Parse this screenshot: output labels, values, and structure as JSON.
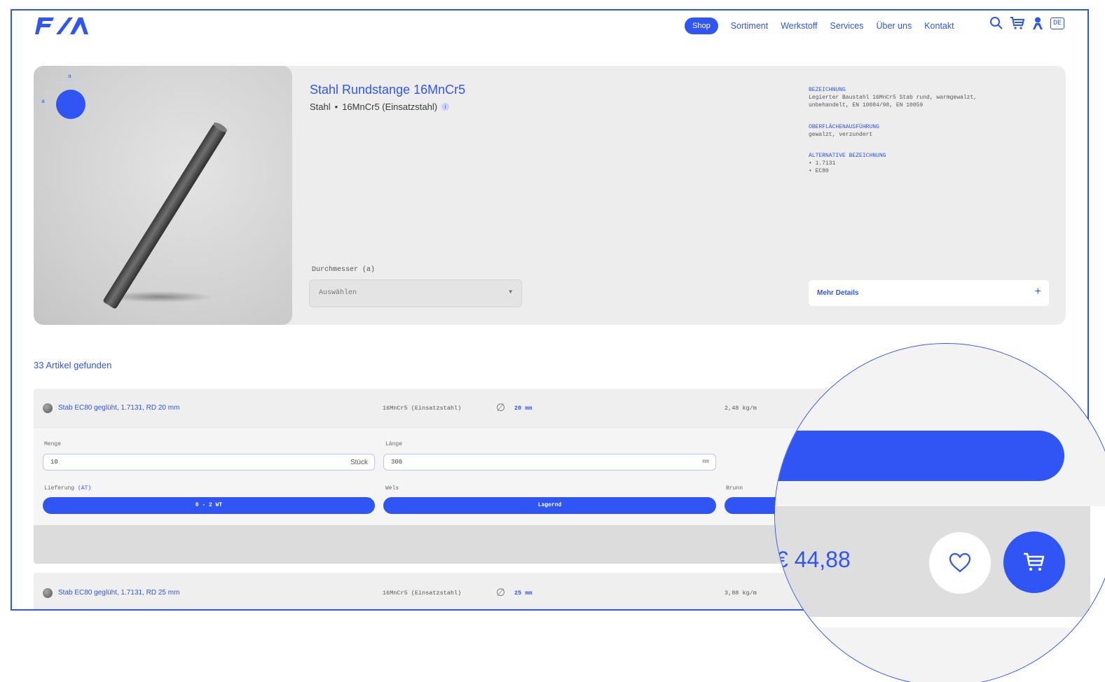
{
  "header": {
    "logo_text": "F/X",
    "nav": [
      "Shop",
      "Sortiment",
      "Werkstoff",
      "Services",
      "Über uns",
      "Kontakt"
    ],
    "language": "DE",
    "icons": [
      "search-icon",
      "cart-icon",
      "user-icon"
    ]
  },
  "product": {
    "title": "Stahl Rundstange 16MnCr5",
    "material": "Stahl",
    "grade": "16MnCr5 (Einsatzstahl)",
    "info_badge": "i",
    "dimension_letter": "a",
    "specs": [
      {
        "label": "BEZEICHNUNG",
        "lines": [
          "Legierter Baustahl 16MnCr5 Stab rund, warmgewalzt,",
          "unbehandelt, EN 10084/98, EN 10059"
        ]
      },
      {
        "label": "OBERFLÄCHENAUSFÜHRUNG",
        "lines": [
          "gewalzt, verzundert"
        ]
      },
      {
        "label": "ALTERNATIVE BEZEICHNUNG",
        "lines": [
          "• 1.7131",
          "• EC80"
        ]
      }
    ],
    "diameter_label": "Durchmesser (a)",
    "diameter_placeholder": "Auswählen",
    "more_details": "Mehr Details",
    "more_details_icon": "+"
  },
  "results": {
    "count_label": "33 Artikel gefunden",
    "articles": [
      {
        "name": "Stab EC80 geglüht, 1.7131, RD 20 mm",
        "grade": "16MnCr5 (Einsatzstahl)",
        "diameter": "20 mm",
        "weight": "2,48 kg/m"
      },
      {
        "name": "Stab EC80 geglüht, 1.7131, RD 25 mm",
        "grade": "16MnCr5 (Einsatzstahl)",
        "diameter": "25 mm",
        "weight": "3,88 kg/m"
      }
    ],
    "order": {
      "quantity_label": "Menge",
      "quantity_value": "10",
      "quantity_unit": "Stück",
      "length_label": "Länge",
      "length_value": "300",
      "length_unit": "mm",
      "delivery_label": "Lieferung",
      "delivery_region": "(AT)",
      "delivery_value": "0 - 2 WT",
      "stock_wels_label": "Wels",
      "stock_wels_value": "Lagernd",
      "stock_brunn_label": "Brunn"
    }
  },
  "magnifier": {
    "price": "€ 44,88",
    "icons": [
      "heart-icon",
      "cart-icon"
    ]
  },
  "colors": {
    "accent": "#2f55f4",
    "panel": "#ededed"
  }
}
